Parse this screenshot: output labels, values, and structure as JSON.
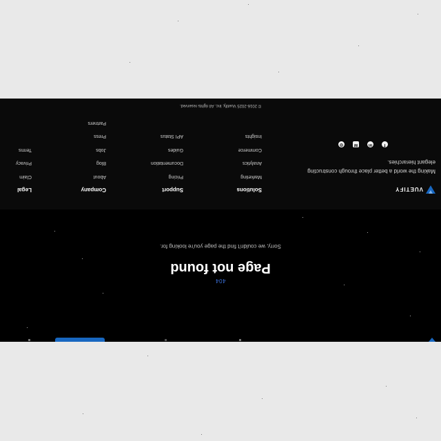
{
  "header": {
    "logo_icon": "vuetify-logo-icon",
    "accent": "#1867c0"
  },
  "not_found": {
    "code": "404",
    "title": "Page not found",
    "subtitle": "Sorry, we couldn't find the page you're looking for."
  },
  "footer": {
    "brand": "VUETIFY",
    "tagline": "Making the world a better place through constructing elegant hierarchies.",
    "socials": [
      {
        "icon": "facebook-icon",
        "glyph": "f"
      },
      {
        "icon": "mastodon-icon",
        "glyph": "m"
      },
      {
        "icon": "medium-icon",
        "glyph": "M"
      },
      {
        "icon": "instagram-icon",
        "glyph": "◎"
      }
    ],
    "columns": [
      {
        "heading": "Solutions",
        "links": [
          "Marketing",
          "Analytics",
          "Commerce",
          "Insights"
        ]
      },
      {
        "heading": "Support",
        "links": [
          "Pricing",
          "Documentation",
          "Guides",
          "API Status"
        ]
      },
      {
        "heading": "Company",
        "links": [
          "About",
          "Blog",
          "Jobs",
          "Press",
          "Partners"
        ]
      },
      {
        "heading": "Legal",
        "links": [
          "Claim",
          "Privacy",
          "Terms"
        ]
      }
    ],
    "copyright": "© 2016-2025 Vuetify, Inc. All rights reserved."
  }
}
